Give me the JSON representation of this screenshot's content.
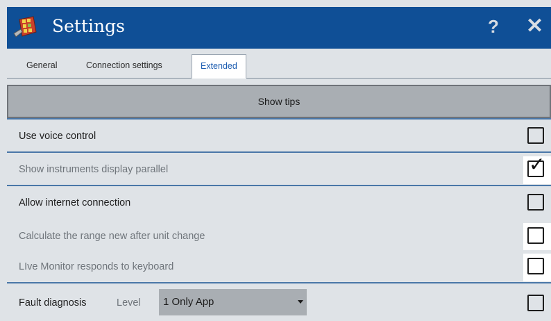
{
  "window": {
    "title": "Settings",
    "help_label": "?",
    "close_label": "✕",
    "accent": "#0f4f96"
  },
  "tabs": [
    {
      "label": "General",
      "active": false
    },
    {
      "label": "Connection settings",
      "active": false
    },
    {
      "label": "Extended",
      "active": true
    }
  ],
  "tips_button": {
    "label": "Show tips"
  },
  "options": [
    {
      "label": "Use voice control",
      "checked": false,
      "enabled": true
    },
    {
      "label": "Show instruments display parallel",
      "checked": true,
      "enabled": false
    },
    {
      "label": "Allow internet connection",
      "checked": false,
      "enabled": true
    },
    {
      "label": "Calculate the range new after unit change",
      "checked": false,
      "enabled": false
    },
    {
      "label": "LIve Monitor responds to keyboard",
      "checked": false,
      "enabled": false
    }
  ],
  "fault": {
    "label": "Fault diagnosis",
    "level_label": "Level",
    "level_value": "1 Only App",
    "checked": false
  }
}
